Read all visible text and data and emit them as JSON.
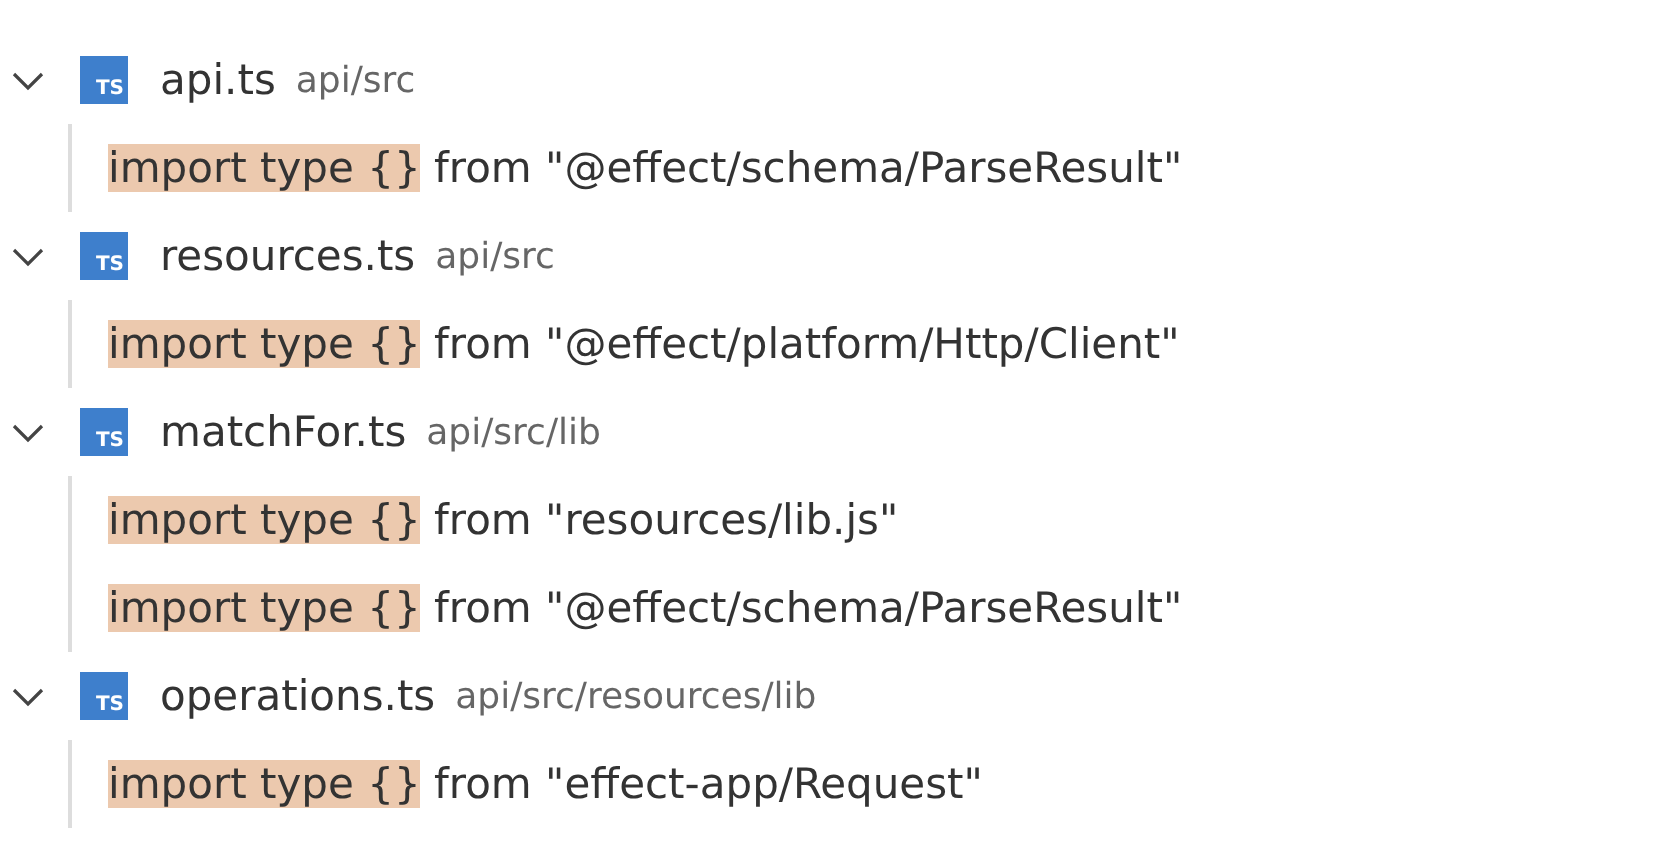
{
  "files": [
    {
      "name": "api.ts",
      "path": "api/src",
      "badge": "TS",
      "expanded": true,
      "matches": [
        {
          "match": "import type {}",
          "rest": " from \"@effect/schema/ParseResult\""
        }
      ]
    },
    {
      "name": "resources.ts",
      "path": "api/src",
      "badge": "TS",
      "expanded": true,
      "matches": [
        {
          "match": "import type {}",
          "rest": " from \"@effect/platform/Http/Client\""
        }
      ]
    },
    {
      "name": "matchFor.ts",
      "path": "api/src/lib",
      "badge": "TS",
      "expanded": true,
      "matches": [
        {
          "match": "import type {}",
          "rest": " from \"resources/lib.js\""
        },
        {
          "match": "import type {}",
          "rest": " from \"@effect/schema/ParseResult\""
        }
      ]
    },
    {
      "name": "operations.ts",
      "path": "api/src/resources/lib",
      "badge": "TS",
      "expanded": true,
      "matches": [
        {
          "match": "import type {}",
          "rest": " from \"effect-app/Request\""
        }
      ]
    }
  ]
}
